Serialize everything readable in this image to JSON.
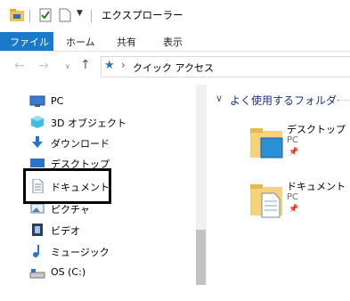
{
  "window": {
    "title": "エクスプローラー"
  },
  "ribbon": {
    "tabs": [
      "ファイル",
      "ホーム",
      "共有",
      "表示"
    ]
  },
  "address": {
    "path": "クイック アクセス",
    "separator": "›"
  },
  "nav": {
    "items": [
      {
        "label": "PC",
        "icon": "pc-icon"
      },
      {
        "label": "3D オブジェクト",
        "icon": "3d-objects-icon"
      },
      {
        "label": "ダウンロード",
        "icon": "download-icon"
      },
      {
        "label": "デスクトップ",
        "icon": "desktop-icon"
      },
      {
        "label": "ドキュメント",
        "icon": "document-icon"
      },
      {
        "label": "ピクチャ",
        "icon": "pictures-icon"
      },
      {
        "label": "ビデオ",
        "icon": "video-icon"
      },
      {
        "label": "ミュージック",
        "icon": "music-icon"
      },
      {
        "label": "OS (C:)",
        "icon": "drive-icon"
      }
    ]
  },
  "content": {
    "section_title": "よく使用するフォルダー (",
    "folders": [
      {
        "name": "デスクトップ",
        "location": "PC"
      },
      {
        "name": "ドキュメント",
        "location": "PC"
      }
    ]
  },
  "colors": {
    "accent": "#1979ca",
    "section": "#1e3287",
    "highlight": "#000000"
  }
}
